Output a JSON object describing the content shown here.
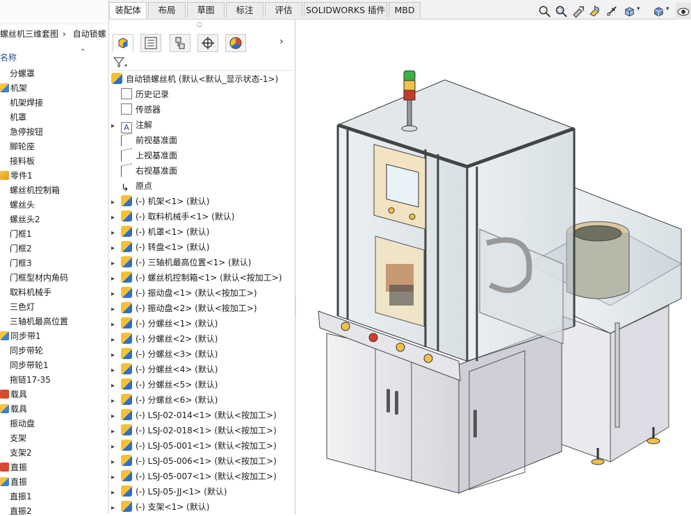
{
  "left_panel": {
    "breadcrumb": [
      "螺丝机三维套图",
      "自动锁螺"
    ],
    "column_header": "名称",
    "items": [
      {
        "label": "分螺罩",
        "icon": "none"
      },
      {
        "label": "机架",
        "icon": "assembly-icon"
      },
      {
        "label": "机架焊接",
        "icon": "none"
      },
      {
        "label": "机罩",
        "icon": "none"
      },
      {
        "label": "急停按钮",
        "icon": "none"
      },
      {
        "label": "脚轮座",
        "icon": "none"
      },
      {
        "label": "接料板",
        "icon": "none"
      },
      {
        "label": "零件1",
        "icon": "part-icon"
      },
      {
        "label": "螺丝机控制箱",
        "icon": "none"
      },
      {
        "label": "螺丝头",
        "icon": "none"
      },
      {
        "label": "螺丝头2",
        "icon": "none"
      },
      {
        "label": "门框1",
        "icon": "none"
      },
      {
        "label": "门框2",
        "icon": "none"
      },
      {
        "label": "门框3",
        "icon": "none"
      },
      {
        "label": "门框型材内角码",
        "icon": "none"
      },
      {
        "label": "取料机械手",
        "icon": "none"
      },
      {
        "label": "三色灯",
        "icon": "none"
      },
      {
        "label": "三轴机最高位置",
        "icon": "none"
      },
      {
        "label": "同步带1",
        "icon": "assembly-icon"
      },
      {
        "label": "同步带轮",
        "icon": "none"
      },
      {
        "label": "同步带轮1",
        "icon": "none"
      },
      {
        "label": "拖链17-35",
        "icon": "none"
      },
      {
        "label": "载具",
        "icon": "library-icon"
      },
      {
        "label": "载具",
        "icon": "assembly-icon"
      },
      {
        "label": "振动盘",
        "icon": "none"
      },
      {
        "label": "支架",
        "icon": "none"
      },
      {
        "label": "支架2",
        "icon": "none"
      },
      {
        "label": "直振",
        "icon": "library-icon"
      },
      {
        "label": "直振",
        "icon": "assembly-icon"
      },
      {
        "label": "直振1",
        "icon": "none"
      },
      {
        "label": "直振2",
        "icon": "none"
      }
    ]
  },
  "tabs": [
    "装配体",
    "布局",
    "草图",
    "标注",
    "评估",
    "SOLIDWORKS 插件",
    "MBD"
  ],
  "active_tab": "装配体",
  "view_toolbar": [
    "zoom-to-fit-icon",
    "zoom-to-area-icon",
    "previous-view-icon",
    "section-view-icon",
    "dynamic-annotation-icon",
    "view-orientation-icon",
    "display-style-icon",
    "hide-show-icon"
  ],
  "feature_tree": {
    "panel_tabs": [
      "feature-manager-icon",
      "property-manager-icon",
      "configuration-manager-icon",
      "dimxpert-icon",
      "display-manager-icon"
    ],
    "root": "自动锁螺丝机 (默认<默认_显示状态-1>)",
    "items": [
      {
        "label": "历史记录",
        "expand": false,
        "icon": "history-icon"
      },
      {
        "label": "传感器",
        "expand": false,
        "icon": "sensor-icon"
      },
      {
        "label": "注解",
        "expand": true,
        "icon": "annotation-icon"
      },
      {
        "label": "前视基准面",
        "expand": false,
        "icon": "plane-icon"
      },
      {
        "label": "上视基准面",
        "expand": false,
        "icon": "plane-icon"
      },
      {
        "label": "右视基准面",
        "expand": false,
        "icon": "plane-icon"
      },
      {
        "label": "原点",
        "expand": false,
        "icon": "origin-icon"
      },
      {
        "label": "(-) 机架<1> (默认)",
        "expand": true,
        "icon": "component-icon"
      },
      {
        "label": "(-) 取料机械手<1> (默认)",
        "expand": true,
        "icon": "component-icon"
      },
      {
        "label": "(-) 机罩<1> (默认)",
        "expand": true,
        "icon": "component-icon"
      },
      {
        "label": "(-) 转盘<1> (默认)",
        "expand": true,
        "icon": "component-icon"
      },
      {
        "label": "(-) 三轴机最高位置<1> (默认)",
        "expand": true,
        "icon": "component-icon"
      },
      {
        "label": "(-) 螺丝机控制箱<1> (默认<按加工>)",
        "expand": true,
        "icon": "component-icon"
      },
      {
        "label": "(-) 振动盘<1> (默认<按加工>)",
        "expand": true,
        "icon": "component-icon"
      },
      {
        "label": "(-) 振动盘<2> (默认<按加工>)",
        "expand": true,
        "icon": "component-icon"
      },
      {
        "label": "(-) 分螺丝<1> (默认)",
        "expand": true,
        "icon": "component-icon"
      },
      {
        "label": "(-) 分螺丝<2> (默认)",
        "expand": true,
        "icon": "component-icon"
      },
      {
        "label": "(-) 分螺丝<3> (默认)",
        "expand": true,
        "icon": "component-icon"
      },
      {
        "label": "(-) 分螺丝<4> (默认)",
        "expand": true,
        "icon": "component-icon"
      },
      {
        "label": "(-) 分螺丝<5> (默认)",
        "expand": true,
        "icon": "component-icon"
      },
      {
        "label": "(-) 分螺丝<6> (默认)",
        "expand": true,
        "icon": "component-icon"
      },
      {
        "label": "(-) LSJ-02-014<1> (默认<按加工>)",
        "expand": true,
        "icon": "component-icon"
      },
      {
        "label": "(-) LSJ-02-018<1> (默认<按加工>)",
        "expand": true,
        "icon": "component-icon"
      },
      {
        "label": "(-) LSJ-05-001<1> (默认<按加工>)",
        "expand": true,
        "icon": "component-icon"
      },
      {
        "label": "(-) LSJ-05-006<1> (默认<按加工>)",
        "expand": true,
        "icon": "component-icon"
      },
      {
        "label": "(-) LSJ-05-007<1> (默认<按加工>)",
        "expand": true,
        "icon": "component-icon"
      },
      {
        "label": "(-) LSJ-05-JJ<1> (默认)",
        "expand": true,
        "icon": "component-icon"
      },
      {
        "label": "(-) 支架<1> (默认)",
        "expand": true,
        "icon": "component-icon"
      }
    ]
  },
  "viewport": {
    "model": "screw-machine-3d-model"
  },
  "colors": {
    "frame": "#c9c9c9",
    "glass": "#b9c7cf",
    "accent_blue": "#2f6fc5",
    "accent_yellow": "#f5c036"
  }
}
